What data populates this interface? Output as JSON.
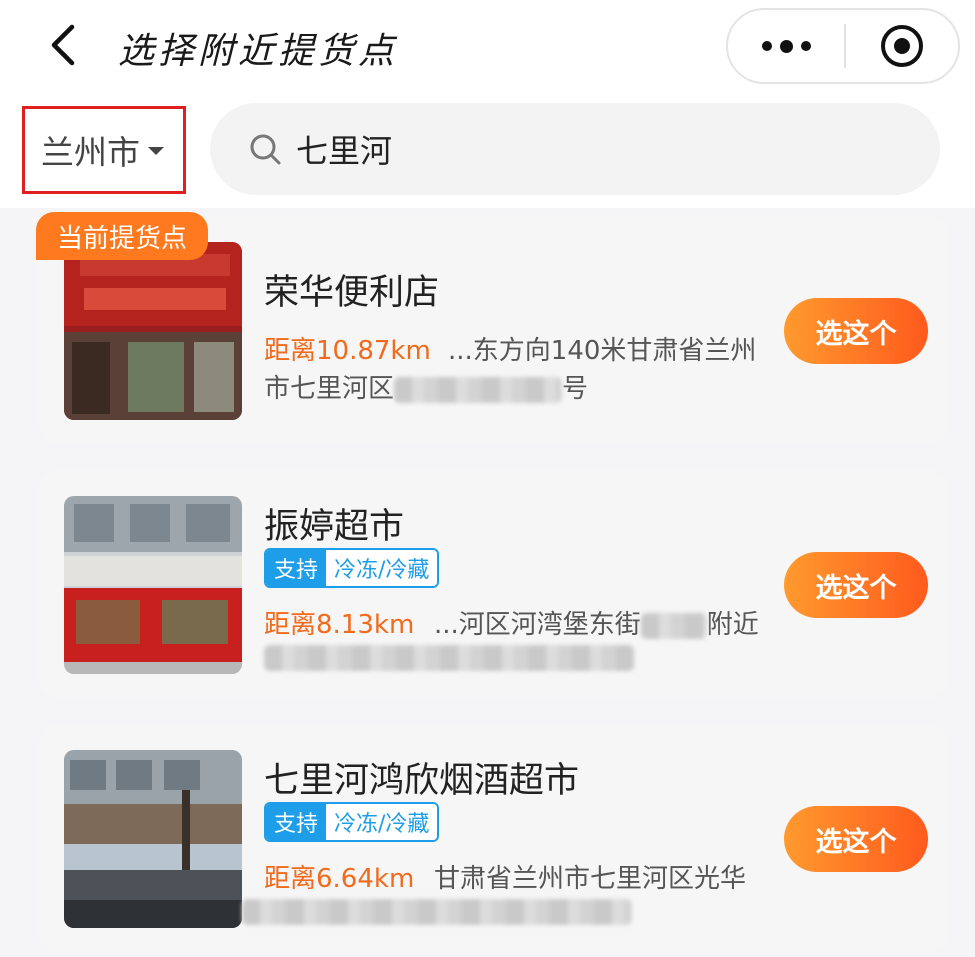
{
  "header": {
    "title": "选择附近提货点"
  },
  "location": {
    "city": "兰州市"
  },
  "search": {
    "value": "七里河"
  },
  "current_badge": "当前提货点",
  "stores": [
    {
      "name": "荣华便利店",
      "distance": "距离10.87km",
      "address_line1": "...东方向140米甘肃省兰州",
      "address_line2_start": "市七里河区",
      "address_line2_end": "号",
      "button": "选这个"
    },
    {
      "name": "振婷超市",
      "tag_left": "支持",
      "tag_right": "冷冻/冷藏",
      "distance": "距离8.13km",
      "address_line1_start": "...河区河湾堡东街",
      "address_line1_end": "附近",
      "button": "选这个"
    },
    {
      "name": "七里河鸿欣烟酒超市",
      "tag_left": "支持",
      "tag_right": "冷冻/冷藏",
      "distance": "距离6.64km",
      "address_line1": "甘肃省兰州市七里河区光华",
      "button": "选这个"
    }
  ],
  "colors": {
    "accent_orange": "#ff7a1e",
    "distance_orange": "#f26a1b",
    "tag_blue": "#1e9ee8",
    "highlight_red": "#e02020"
  }
}
